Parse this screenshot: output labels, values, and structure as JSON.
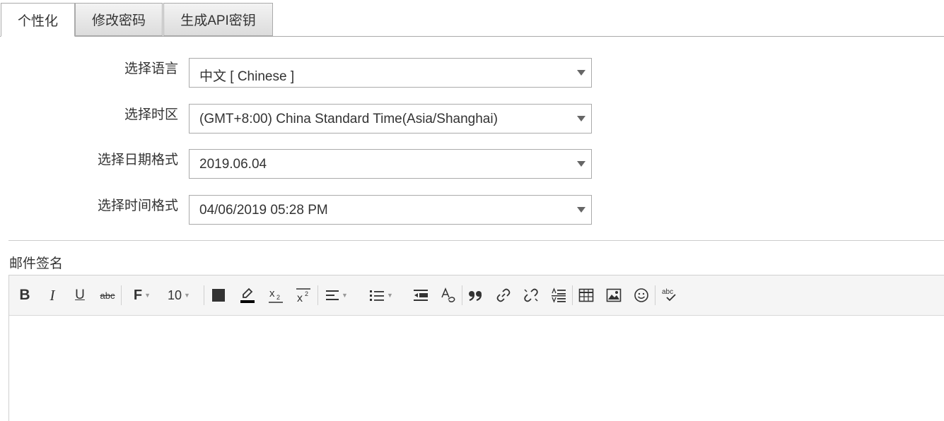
{
  "tabs": [
    {
      "label": "个性化",
      "active": true
    },
    {
      "label": "修改密码",
      "active": false
    },
    {
      "label": "生成API密钥",
      "active": false
    }
  ],
  "form": {
    "language": {
      "label": "选择语言",
      "value": "中文 [ Chinese ]"
    },
    "timezone": {
      "label": "选择时区",
      "value": "(GMT+8:00) China Standard Time(Asia/Shanghai)"
    },
    "date_format": {
      "label": "选择日期格式",
      "value": "2019.06.04"
    },
    "time_format": {
      "label": "选择时间格式",
      "value": "04/06/2019 05:28 PM"
    }
  },
  "signature": {
    "label": "邮件签名",
    "toolbar": {
      "bold": "B",
      "italic": "I",
      "underline": "U",
      "strikethrough": "abc",
      "font_family": "F",
      "font_size": "10",
      "superscript_mark": "2",
      "subscript_mark": "2",
      "subscript_base": "x",
      "superscript_base": "x",
      "spellcheck": "abc"
    },
    "content": ""
  },
  "colors": {
    "border": "#aaaaaa",
    "toolbar_bg": "#f5f5f5",
    "text": "#333333"
  }
}
